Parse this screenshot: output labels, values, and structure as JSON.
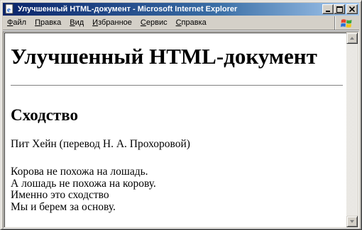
{
  "window": {
    "title": "Улучшенный HTML-документ - Microsoft Internet Explorer"
  },
  "menu": {
    "items": [
      {
        "first": "Ф",
        "rest": "айл"
      },
      {
        "first": "П",
        "rest": "равка"
      },
      {
        "first": "В",
        "rest": "ид"
      },
      {
        "first": "И",
        "rest": "збранное"
      },
      {
        "first": "С",
        "rest": "ервис"
      },
      {
        "first": "С",
        "rest": "правка"
      }
    ]
  },
  "document": {
    "heading": "Улучшенный HTML-документ",
    "subheading": "Сходство",
    "author": "Пит Хейн (перевод Н. А. Прохоровой)",
    "poem": [
      "Корова не похожа на лошадь.",
      "А лошадь не похожа на корову.",
      "Именно это сходство",
      "Мы и берем за основу."
    ]
  },
  "icons": {
    "app": "ie-page-icon",
    "minimize": "minimize-icon",
    "maximize": "maximize-icon",
    "close": "close-icon",
    "throbber": "windows-logo-icon",
    "scroll_up": "arrow-up-icon",
    "scroll_down": "arrow-down-icon"
  }
}
